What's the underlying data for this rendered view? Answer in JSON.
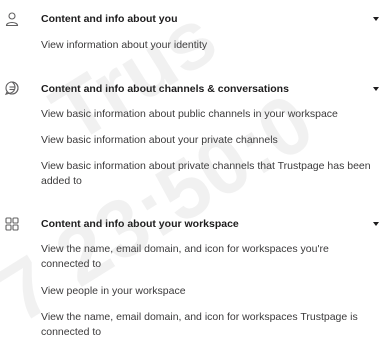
{
  "sections": [
    {
      "icon": "person-icon",
      "title": "Content and info about you",
      "items": [
        "View information about your identity"
      ]
    },
    {
      "icon": "chat-bubble-icon",
      "title": "Content and info about channels & conversations",
      "items": [
        "View basic information about public channels in your workspace",
        "View basic information about your private channels",
        "View basic information about private channels that Trustpage has been added to"
      ]
    },
    {
      "icon": "grid-icon",
      "title": "Content and info about your workspace",
      "items": [
        "View the name, email domain, and icon for workspaces you're connected to",
        "View people in your workspace",
        "View the name, email domain, and icon for workspaces Trustpage is connected to"
      ]
    }
  ],
  "watermark": {
    "line1": "Trus",
    "line2": "7 23:50:0"
  },
  "colors": {
    "text": "#1d1c1d",
    "secondary_text": "#3b3a3b",
    "icon": "#616061"
  }
}
